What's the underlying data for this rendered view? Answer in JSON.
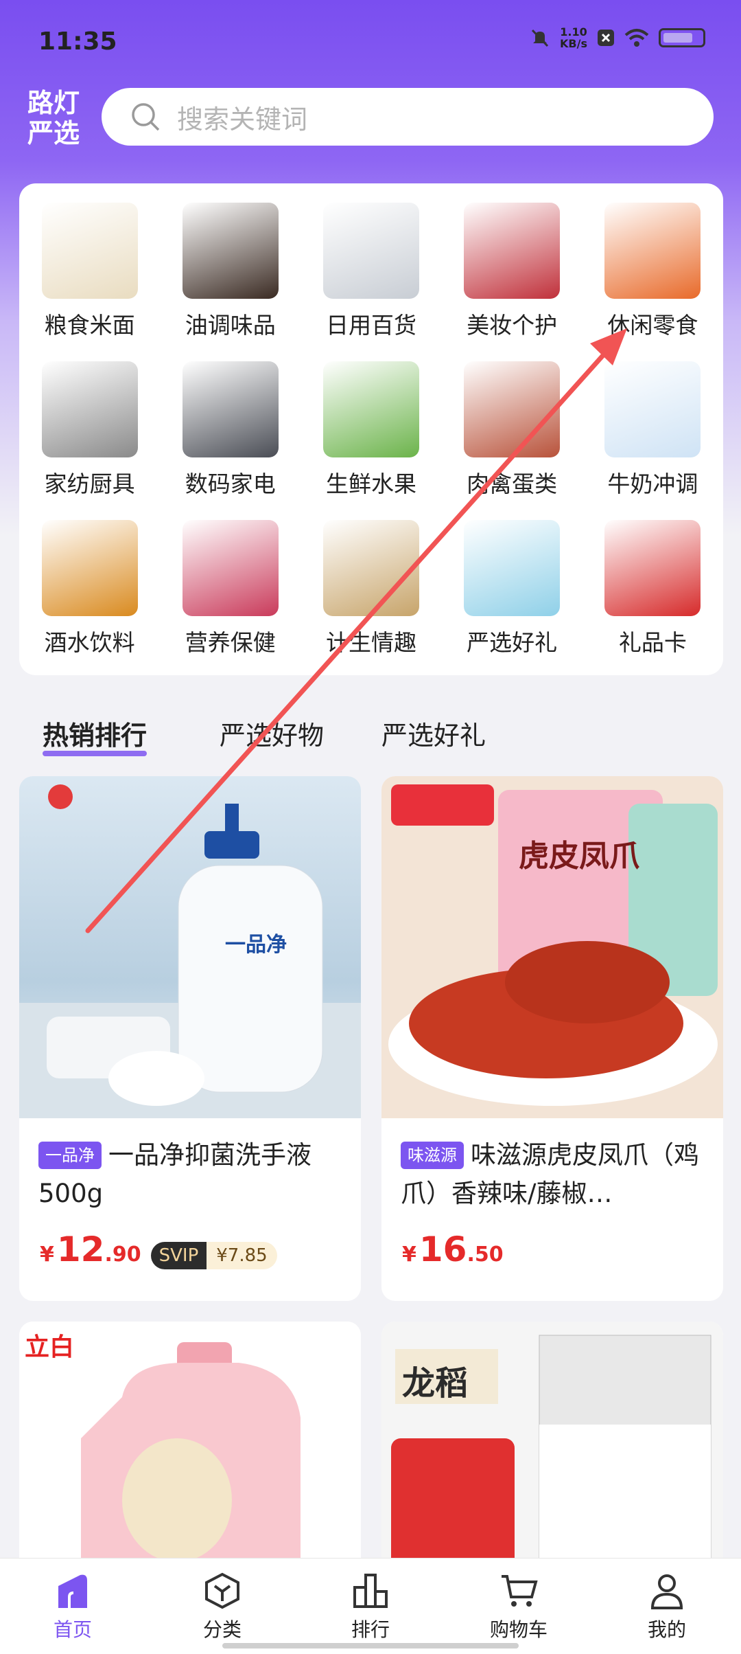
{
  "status": {
    "time": "11:35",
    "net_speed_value": "1.10",
    "net_speed_unit": "KB/s"
  },
  "header": {
    "logo_line1": "路灯",
    "logo_line2": "严选",
    "search_placeholder": "搜索关键词"
  },
  "categories": [
    {
      "label": "粮食米面",
      "icon": "rice-bags-icon",
      "color": "#e9dcc0"
    },
    {
      "label": "油调味品",
      "icon": "sauce-bottles-icon",
      "color": "#3a2a22"
    },
    {
      "label": "日用百货",
      "icon": "trash-can-icon",
      "color": "#c8cdd4"
    },
    {
      "label": "美妆个护",
      "icon": "cosmetics-icon",
      "color": "#c0303a"
    },
    {
      "label": "休闲零食",
      "icon": "snacks-icon",
      "color": "#e86a2a"
    },
    {
      "label": "家纺厨具",
      "icon": "cookware-icon",
      "color": "#8a8a8a"
    },
    {
      "label": "数码家电",
      "icon": "appliances-icon",
      "color": "#4a4d55"
    },
    {
      "label": "生鲜水果",
      "icon": "fruit-icon",
      "color": "#6bb34a"
    },
    {
      "label": "肉禽蛋类",
      "icon": "meat-icon",
      "color": "#b8523a"
    },
    {
      "label": "牛奶冲调",
      "icon": "milk-icon",
      "color": "#cfe3f5"
    },
    {
      "label": "酒水饮料",
      "icon": "drinks-icon",
      "color": "#d98a1f"
    },
    {
      "label": "营养保健",
      "icon": "supplements-icon",
      "color": "#c93a5a"
    },
    {
      "label": "计生情趣",
      "icon": "adult-icon",
      "color": "#c7a46a"
    },
    {
      "label": "严选好礼",
      "icon": "gift-box-icon",
      "color": "#8fd0e8"
    },
    {
      "label": "礼品卡",
      "icon": "gift-card-icon",
      "color": "#d62a2a"
    }
  ],
  "tabs": [
    "热销排行",
    "严选好物",
    "严选好礼"
  ],
  "products": [
    {
      "badge": "一品净",
      "title": "一品净抑菌洗手液500g",
      "price_currency": "¥",
      "price_int": "12",
      "price_dec": ".90",
      "svip_label": "SVIP",
      "svip_price": "¥7.85",
      "image_text": "一品净",
      "image_bg": "#cfe0ee"
    },
    {
      "badge": "味滋源",
      "title": "味滋源虎皮凤爪（鸡爪）香辣味/藤椒…",
      "price_currency": "¥",
      "price_int": "16",
      "price_dec": ".50",
      "image_text": "虎皮凤爪",
      "image_bg": "#f3e4d6"
    },
    {
      "image_text": "立白",
      "image_bg": "#ffffff"
    },
    {
      "image_text": "龙稻",
      "image_bg": "#f5f5f5"
    }
  ],
  "nav": [
    {
      "label": "首页",
      "icon": "home-icon"
    },
    {
      "label": "分类",
      "icon": "category-icon"
    },
    {
      "label": "排行",
      "icon": "ranking-icon"
    },
    {
      "label": "购物车",
      "icon": "cart-icon"
    },
    {
      "label": "我的",
      "icon": "profile-icon"
    }
  ],
  "accent": "#7c55f0",
  "price_color": "#e52a2a"
}
